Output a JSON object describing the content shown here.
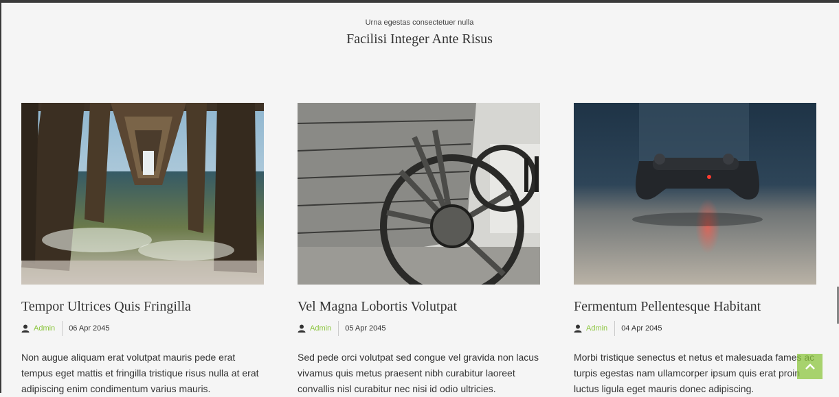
{
  "section": {
    "subtitle": "Urna egestas consectetuer nulla",
    "title": "Facilisi Integer Ante Risus"
  },
  "posts": [
    {
      "title": "Tempor Ultrices Quis Fringilla",
      "author": "Admin",
      "date": "06 Apr 2045",
      "excerpt": "Non augue aliquam erat volutpat mauris pede erat tempus eget mattis et fringilla tristique risus nulla at erat adipiscing enim condimentum varius mauris.",
      "image_icon": "pier-photo"
    },
    {
      "title": "Vel Magna Lobortis Volutpat",
      "author": "Admin",
      "date": "05 Apr 2045",
      "excerpt": "Sed pede orci volutpat sed congue vel gravida non lacus vivamus quis metus praesent nibh curabitur laoreet convallis nisl curabitur nec nisi id odio ultricies.",
      "image_icon": "wagon-wheel-photo"
    },
    {
      "title": "Fermentum Pellentesque Habitant",
      "author": "Admin",
      "date": "04 Apr 2045",
      "excerpt": "Morbi tristique senectus et netus et malesuada fames ac turpis egestas nam ullamcorper ipsum quis erat proin luctus ligula eget mauris donec adipiscing.",
      "image_icon": "game-controller-photo"
    }
  ],
  "colors": {
    "accent": "#8cc63f",
    "background": "#f5f5f5",
    "text": "#333333"
  },
  "icons": {
    "author": "user-icon",
    "scroll_top": "chevron-up-icon"
  }
}
